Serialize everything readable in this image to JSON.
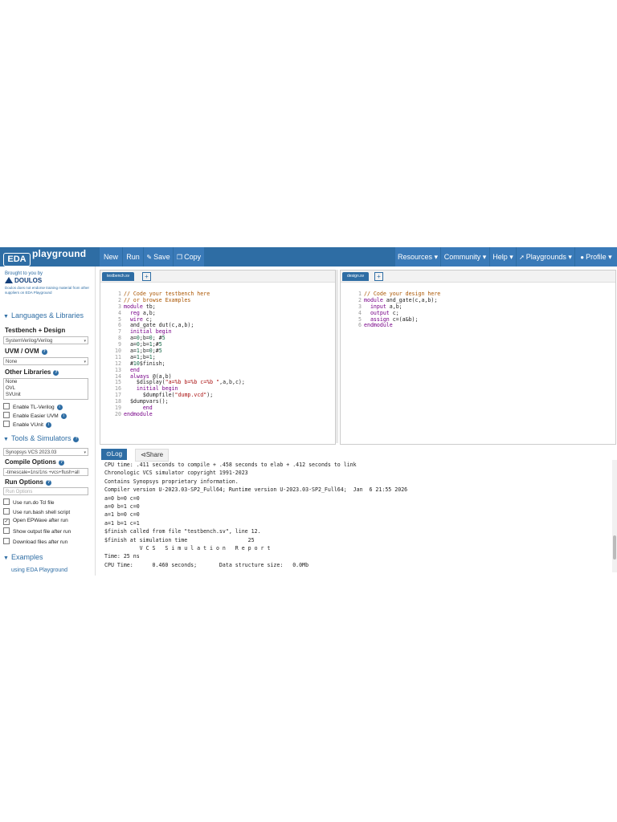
{
  "brand": {
    "eda": "EDA",
    "playground": "playground"
  },
  "nav": {
    "new": "New",
    "run": "Run",
    "save": "Save",
    "copy": "Copy",
    "resources": "Resources",
    "community": "Community",
    "help": "Help",
    "playgrounds": "Playgrounds",
    "profile": "Profile"
  },
  "sidebar": {
    "brought_by": "Brought to you by",
    "doulos": "DOULOS",
    "disclaimer": "Doulos does not endorse training material from other suppliers on EDA Playground",
    "languages_head": "Languages & Libraries",
    "tb_design_label": "Testbench + Design",
    "tb_design_value": "SystemVerilog/Verilog",
    "uvm_label": "UVM / OVM",
    "uvm_value": "None",
    "other_libs_label": "Other Libraries",
    "other_libs": [
      "None",
      "OVL",
      "SVUnit"
    ],
    "enable_tl": "Enable TL-Verilog",
    "enable_easier": "Enable Easier UVM",
    "enable_vunit": "Enable VUnit",
    "tools_head": "Tools & Simulators",
    "simulator_value": "Synopsys VCS 2023.03",
    "compile_label": "Compile Options",
    "compile_value": "-timescale=1ns/1ns +vcs+flush+all",
    "run_label": "Run Options",
    "run_placeholder": "Run Options",
    "use_run_do": "Use run.do Tcl file",
    "use_run_bash": "Use run.bash shell script",
    "open_epwave": "Open EPWave after run",
    "show_output": "Show output file after run",
    "download_files": "Download files after run",
    "examples_head": "Examples",
    "using_eda": "using EDA Playground"
  },
  "editors": {
    "left": {
      "tab": "testbench.sv",
      "lines": [
        [
          {
            "t": "// Code your testbench here",
            "c": "comment"
          }
        ],
        [
          {
            "t": "// or browse Examples",
            "c": "comment"
          }
        ],
        [
          {
            "t": "module",
            "c": "kw"
          },
          {
            "t": " tb;",
            "c": "def"
          }
        ],
        [
          {
            "t": "  reg",
            "c": "kw"
          },
          {
            "t": " a,b;",
            "c": "def"
          }
        ],
        [
          {
            "t": "  wire",
            "c": "kw"
          },
          {
            "t": " c;",
            "c": "def"
          }
        ],
        [
          {
            "t": "  and_gate dut(c,a,b);",
            "c": "def"
          }
        ],
        [
          {
            "t": "  initial",
            "c": "kw"
          },
          {
            "t": " ",
            "c": "def"
          },
          {
            "t": "begin",
            "c": "kw"
          }
        ],
        [
          {
            "t": "  a=",
            "c": "def"
          },
          {
            "t": "0",
            "c": "num"
          },
          {
            "t": ";b=",
            "c": "def"
          },
          {
            "t": "0",
            "c": "num"
          },
          {
            "t": "; #",
            "c": "def"
          },
          {
            "t": "5",
            "c": "num"
          }
        ],
        [
          {
            "t": "  a=",
            "c": "def"
          },
          {
            "t": "0",
            "c": "num"
          },
          {
            "t": ";b=",
            "c": "def"
          },
          {
            "t": "1",
            "c": "num"
          },
          {
            "t": ";#",
            "c": "def"
          },
          {
            "t": "5",
            "c": "num"
          }
        ],
        [
          {
            "t": "  a=",
            "c": "def"
          },
          {
            "t": "1",
            "c": "num"
          },
          {
            "t": ";b=",
            "c": "def"
          },
          {
            "t": "0",
            "c": "num"
          },
          {
            "t": ";#",
            "c": "def"
          },
          {
            "t": "5",
            "c": "num"
          }
        ],
        [
          {
            "t": "  a=",
            "c": "def"
          },
          {
            "t": "1",
            "c": "num"
          },
          {
            "t": ";b=",
            "c": "def"
          },
          {
            "t": "1",
            "c": "num"
          },
          {
            "t": ";",
            "c": "def"
          }
        ],
        [
          {
            "t": "  #",
            "c": "def"
          },
          {
            "t": "10",
            "c": "num"
          },
          {
            "t": "$finish;",
            "c": "def"
          }
        ],
        [
          {
            "t": "  end",
            "c": "kw"
          }
        ],
        [
          {
            "t": "  always",
            "c": "kw"
          },
          {
            "t": " @(a,b)",
            "c": "def"
          }
        ],
        [
          {
            "t": "    $display(",
            "c": "def"
          },
          {
            "t": "\"a=%b b=%b c=%b \"",
            "c": "str"
          },
          {
            "t": ",a,b,c);",
            "c": "def"
          }
        ],
        [
          {
            "t": "    initial",
            "c": "kw"
          },
          {
            "t": " ",
            "c": "def"
          },
          {
            "t": "begin",
            "c": "kw"
          }
        ],
        [
          {
            "t": "      $dumpfile(",
            "c": "def"
          },
          {
            "t": "\"dump.vcd\"",
            "c": "str"
          },
          {
            "t": ");",
            "c": "def"
          }
        ],
        [
          {
            "t": "  $dumpvars();",
            "c": "def"
          }
        ],
        [
          {
            "t": "      end",
            "c": "kw"
          }
        ],
        [
          {
            "t": "endmodule",
            "c": "kw"
          }
        ]
      ]
    },
    "right": {
      "tab": "design.sv",
      "lines": [
        [
          {
            "t": "// Code your design here",
            "c": "comment"
          }
        ],
        [
          {
            "t": "module",
            "c": "kw"
          },
          {
            "t": " and_gate(c,a,b);",
            "c": "def"
          }
        ],
        [
          {
            "t": "  input",
            "c": "kw"
          },
          {
            "t": " a,b;",
            "c": "def"
          }
        ],
        [
          {
            "t": "  output",
            "c": "kw"
          },
          {
            "t": " c;",
            "c": "def"
          }
        ],
        [
          {
            "t": "  assign",
            "c": "kw"
          },
          {
            "t": " c=(a&b);",
            "c": "def"
          }
        ],
        [
          {
            "t": "endmodule",
            "c": "kw"
          }
        ]
      ]
    }
  },
  "log": {
    "tab_log": "Log",
    "tab_share": "Share",
    "lines": [
      "CPU time: .411 seconds to compile + .458 seconds to elab + .412 seconds to link",
      "Chronologic VCS simulator copyright 1991-2023",
      "Contains Synopsys proprietary information.",
      "Compiler version U-2023.03-SP2_Full64; Runtime version U-2023.03-SP2_Full64;  Jan  6 21:55 2026",
      "a=0 b=0 c=0",
      "a=0 b=1 c=0",
      "a=1 b=0 c=0",
      "a=1 b=1 c=1",
      "$finish called from file \"testbench.sv\", line 12.",
      "$finish at simulation time                   25",
      "           V C S   S i m u l a t i o n   R e p o r t",
      "Time: 25 ns",
      "CPU Time:      0.460 seconds;       Data structure size:   0.0Mb"
    ]
  },
  "colors": {
    "primary": "#2e6da4",
    "comment": "#aa5500",
    "keyword": "#770088",
    "number": "#116644",
    "string": "#aa1111"
  }
}
